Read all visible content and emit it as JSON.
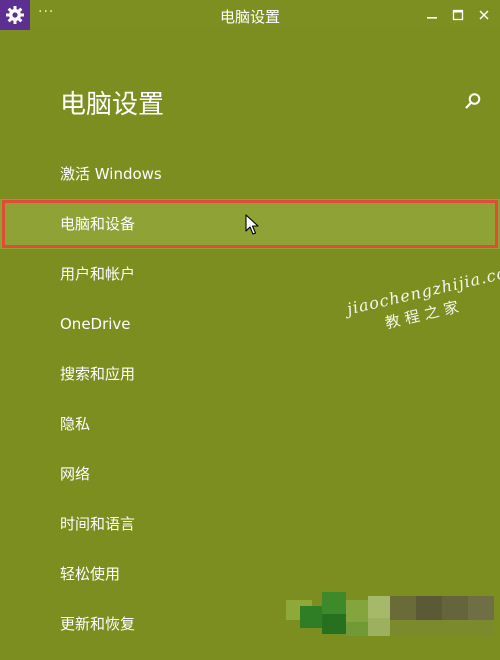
{
  "window": {
    "title": "电脑设置",
    "menu_glyph": "···",
    "app_icon": "gear-icon",
    "controls": [
      "minimize-icon",
      "maximize-icon",
      "close-icon"
    ]
  },
  "page": {
    "title": "电脑设置",
    "search_icon": "search-icon"
  },
  "nav": {
    "items": [
      {
        "label": "激活 Windows"
      },
      {
        "label": "电脑和设备",
        "selected": true
      },
      {
        "label": "用户和帐户"
      },
      {
        "label": "OneDrive"
      },
      {
        "label": "搜索和应用"
      },
      {
        "label": "隐私"
      },
      {
        "label": "网络"
      },
      {
        "label": "时间和语言"
      },
      {
        "label": "轻松使用"
      },
      {
        "label": "更新和恢复"
      }
    ]
  },
  "watermark": {
    "line1": "jiaochengzhijia.com",
    "line2": "教程之家"
  },
  "colors": {
    "background": "#7b8e1f",
    "selected": "#8ea235",
    "highlight_border": "#e24b37",
    "app_icon_bg": "#5e2f93"
  }
}
